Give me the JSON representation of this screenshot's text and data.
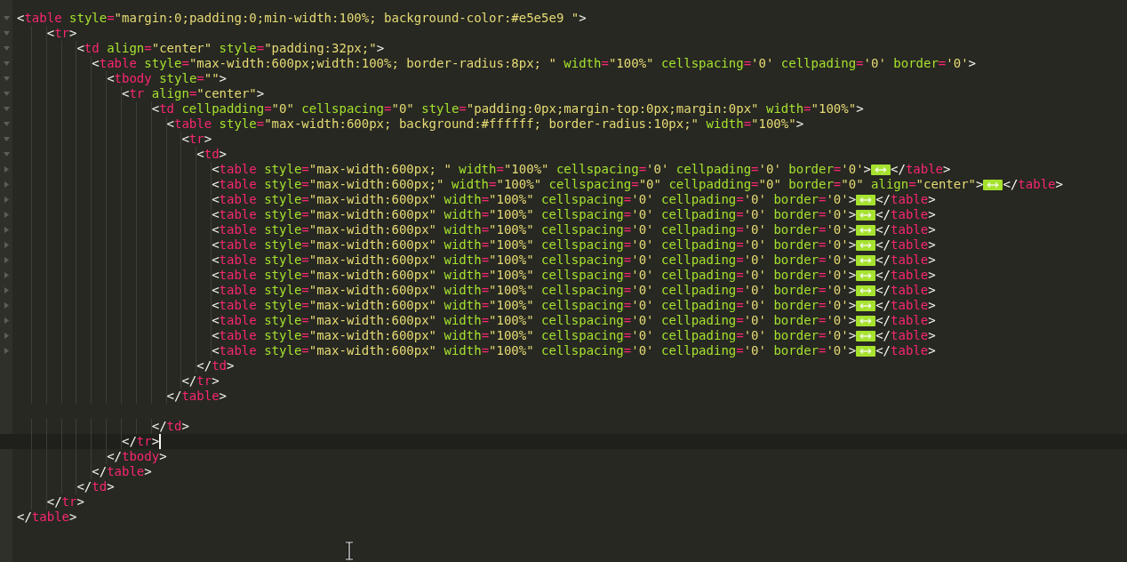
{
  "editor": {
    "lines": [
      {
        "expanded": true,
        "current": false,
        "tokens": [
          {
            "kind": "p",
            "text": "<"
          },
          {
            "kind": "tag",
            "text": "table"
          },
          {
            "kind": "attr",
            "text": " style"
          },
          {
            "kind": "eq",
            "text": "="
          },
          {
            "kind": "str",
            "text": "\"margin:0;padding:0;min-width:100%; background-color:#e5e5e9 \""
          },
          {
            "kind": "p",
            "text": ">"
          }
        ]
      },
      {
        "expanded": true,
        "current": false,
        "tokens": [
          {
            "kind": "p",
            "text": "    <"
          },
          {
            "kind": "tag",
            "text": "tr"
          },
          {
            "kind": "p",
            "text": ">"
          }
        ]
      },
      {
        "expanded": true,
        "current": false,
        "tokens": [
          {
            "kind": "p",
            "text": "        <"
          },
          {
            "kind": "tag",
            "text": "td"
          },
          {
            "kind": "attr",
            "text": " align"
          },
          {
            "kind": "eq",
            "text": "="
          },
          {
            "kind": "str",
            "text": "\"center\""
          },
          {
            "kind": "attr",
            "text": " style"
          },
          {
            "kind": "eq",
            "text": "="
          },
          {
            "kind": "str",
            "text": "\"padding:32px;\""
          },
          {
            "kind": "p",
            "text": ">"
          }
        ]
      },
      {
        "expanded": true,
        "current": false,
        "tokens": [
          {
            "kind": "p",
            "text": "          <"
          },
          {
            "kind": "tag",
            "text": "table"
          },
          {
            "kind": "attr",
            "text": " style"
          },
          {
            "kind": "eq",
            "text": "="
          },
          {
            "kind": "str",
            "text": "\"max-width:600px;width:100%; border-radius:8px; \""
          },
          {
            "kind": "attr",
            "text": " width"
          },
          {
            "kind": "eq",
            "text": "="
          },
          {
            "kind": "str",
            "text": "\"100%\""
          },
          {
            "kind": "attr",
            "text": " cellspacing"
          },
          {
            "kind": "eq",
            "text": "="
          },
          {
            "kind": "str",
            "text": "'0'"
          },
          {
            "kind": "attr",
            "text": " cellpading"
          },
          {
            "kind": "eq",
            "text": "="
          },
          {
            "kind": "str",
            "text": "'0'"
          },
          {
            "kind": "attr",
            "text": " border"
          },
          {
            "kind": "eq",
            "text": "="
          },
          {
            "kind": "str",
            "text": "'0'"
          },
          {
            "kind": "p",
            "text": ">"
          }
        ]
      },
      {
        "expanded": true,
        "current": false,
        "tokens": [
          {
            "kind": "p",
            "text": "            <"
          },
          {
            "kind": "tag",
            "text": "tbody"
          },
          {
            "kind": "attr",
            "text": " style"
          },
          {
            "kind": "eq",
            "text": "="
          },
          {
            "kind": "str",
            "text": "\"\""
          },
          {
            "kind": "p",
            "text": ">"
          }
        ]
      },
      {
        "expanded": true,
        "current": false,
        "tokens": [
          {
            "kind": "p",
            "text": "              <"
          },
          {
            "kind": "tag",
            "text": "tr"
          },
          {
            "kind": "attr",
            "text": " align"
          },
          {
            "kind": "eq",
            "text": "="
          },
          {
            "kind": "str",
            "text": "\"center\""
          },
          {
            "kind": "p",
            "text": ">"
          }
        ]
      },
      {
        "expanded": true,
        "current": false,
        "tokens": [
          {
            "kind": "p",
            "text": "                  <"
          },
          {
            "kind": "tag",
            "text": "td"
          },
          {
            "kind": "attr",
            "text": " cellpadding"
          },
          {
            "kind": "eq",
            "text": "="
          },
          {
            "kind": "str",
            "text": "\"0\""
          },
          {
            "kind": "attr",
            "text": " cellspacing"
          },
          {
            "kind": "eq",
            "text": "="
          },
          {
            "kind": "str",
            "text": "\"0\""
          },
          {
            "kind": "attr",
            "text": " style"
          },
          {
            "kind": "eq",
            "text": "="
          },
          {
            "kind": "str",
            "text": "\"padding:0px;margin-top:0px;margin:0px\""
          },
          {
            "kind": "attr",
            "text": " width"
          },
          {
            "kind": "eq",
            "text": "="
          },
          {
            "kind": "str",
            "text": "\"100%\""
          },
          {
            "kind": "p",
            "text": ">"
          }
        ]
      },
      {
        "expanded": true,
        "current": false,
        "tokens": [
          {
            "kind": "p",
            "text": "                    <"
          },
          {
            "kind": "tag",
            "text": "table"
          },
          {
            "kind": "attr",
            "text": " style"
          },
          {
            "kind": "eq",
            "text": "="
          },
          {
            "kind": "str",
            "text": "\"max-width:600px; background:#ffffff; border-radius:10px;\""
          },
          {
            "kind": "attr",
            "text": " width"
          },
          {
            "kind": "eq",
            "text": "="
          },
          {
            "kind": "str",
            "text": "\"100%\""
          },
          {
            "kind": "p",
            "text": ">"
          }
        ]
      },
      {
        "expanded": true,
        "current": false,
        "tokens": [
          {
            "kind": "p",
            "text": "                      <"
          },
          {
            "kind": "tag",
            "text": "tr"
          },
          {
            "kind": "p",
            "text": ">"
          }
        ]
      },
      {
        "expanded": true,
        "current": false,
        "tokens": [
          {
            "kind": "p",
            "text": "                        <"
          },
          {
            "kind": "tag",
            "text": "td"
          },
          {
            "kind": "p",
            "text": ">"
          }
        ]
      },
      {
        "expanded": false,
        "current": false,
        "tokens": [
          {
            "kind": "p",
            "text": "                          <"
          },
          {
            "kind": "tag",
            "text": "table"
          },
          {
            "kind": "attr",
            "text": " style"
          },
          {
            "kind": "eq",
            "text": "="
          },
          {
            "kind": "str",
            "text": "\"max-width:600px; \""
          },
          {
            "kind": "attr",
            "text": " width"
          },
          {
            "kind": "eq",
            "text": "="
          },
          {
            "kind": "str",
            "text": "\"100%\""
          },
          {
            "kind": "attr",
            "text": " cellspacing"
          },
          {
            "kind": "eq",
            "text": "="
          },
          {
            "kind": "str",
            "text": "'0'"
          },
          {
            "kind": "attr",
            "text": " cellpading"
          },
          {
            "kind": "eq",
            "text": "="
          },
          {
            "kind": "str",
            "text": "'0'"
          },
          {
            "kind": "attr",
            "text": " border"
          },
          {
            "kind": "eq",
            "text": "="
          },
          {
            "kind": "str",
            "text": "'0'"
          },
          {
            "kind": "p",
            "text": ">"
          },
          {
            "kind": "fold"
          },
          {
            "kind": "p",
            "text": "</"
          },
          {
            "kind": "tag",
            "text": "table"
          },
          {
            "kind": "p",
            "text": ">"
          }
        ]
      },
      {
        "expanded": false,
        "current": false,
        "tokens": [
          {
            "kind": "p",
            "text": "                          <"
          },
          {
            "kind": "tag",
            "text": "table"
          },
          {
            "kind": "attr",
            "text": " style"
          },
          {
            "kind": "eq",
            "text": "="
          },
          {
            "kind": "str",
            "text": "\"max-width:600px;\""
          },
          {
            "kind": "attr",
            "text": " width"
          },
          {
            "kind": "eq",
            "text": "="
          },
          {
            "kind": "str",
            "text": "\"100%\""
          },
          {
            "kind": "attr",
            "text": " cellspacing"
          },
          {
            "kind": "eq",
            "text": "="
          },
          {
            "kind": "str",
            "text": "\"0\""
          },
          {
            "kind": "attr",
            "text": " cellpadding"
          },
          {
            "kind": "eq",
            "text": "="
          },
          {
            "kind": "str",
            "text": "\"0\""
          },
          {
            "kind": "attr",
            "text": " border"
          },
          {
            "kind": "eq",
            "text": "="
          },
          {
            "kind": "str",
            "text": "\"0\""
          },
          {
            "kind": "attr",
            "text": " align"
          },
          {
            "kind": "eq",
            "text": "="
          },
          {
            "kind": "str",
            "text": "\"center\""
          },
          {
            "kind": "p",
            "text": ">"
          },
          {
            "kind": "fold"
          },
          {
            "kind": "p",
            "text": "</"
          },
          {
            "kind": "tag",
            "text": "table"
          },
          {
            "kind": "p",
            "text": ">"
          }
        ]
      },
      {
        "expanded": false,
        "current": false,
        "tokens": [
          {
            "kind": "p",
            "text": "                          <"
          },
          {
            "kind": "tag",
            "text": "table"
          },
          {
            "kind": "attr",
            "text": " style"
          },
          {
            "kind": "eq",
            "text": "="
          },
          {
            "kind": "str",
            "text": "\"max-width:600px\""
          },
          {
            "kind": "attr",
            "text": " width"
          },
          {
            "kind": "eq",
            "text": "="
          },
          {
            "kind": "str",
            "text": "\"100%\""
          },
          {
            "kind": "attr",
            "text": " cellspacing"
          },
          {
            "kind": "eq",
            "text": "="
          },
          {
            "kind": "str",
            "text": "'0'"
          },
          {
            "kind": "attr",
            "text": " cellpading"
          },
          {
            "kind": "eq",
            "text": "="
          },
          {
            "kind": "str",
            "text": "'0'"
          },
          {
            "kind": "attr",
            "text": " border"
          },
          {
            "kind": "eq",
            "text": "="
          },
          {
            "kind": "str",
            "text": "'0'"
          },
          {
            "kind": "p",
            "text": ">"
          },
          {
            "kind": "fold"
          },
          {
            "kind": "p",
            "text": "</"
          },
          {
            "kind": "tag",
            "text": "table"
          },
          {
            "kind": "p",
            "text": ">"
          }
        ]
      },
      {
        "expanded": false,
        "current": false,
        "tokens": [
          {
            "kind": "p",
            "text": "                          <"
          },
          {
            "kind": "tag",
            "text": "table"
          },
          {
            "kind": "attr",
            "text": " style"
          },
          {
            "kind": "eq",
            "text": "="
          },
          {
            "kind": "str",
            "text": "\"max-width:600px\""
          },
          {
            "kind": "attr",
            "text": " width"
          },
          {
            "kind": "eq",
            "text": "="
          },
          {
            "kind": "str",
            "text": "\"100%\""
          },
          {
            "kind": "attr",
            "text": " cellspacing"
          },
          {
            "kind": "eq",
            "text": "="
          },
          {
            "kind": "str",
            "text": "'0'"
          },
          {
            "kind": "attr",
            "text": " cellpading"
          },
          {
            "kind": "eq",
            "text": "="
          },
          {
            "kind": "str",
            "text": "'0'"
          },
          {
            "kind": "attr",
            "text": " border"
          },
          {
            "kind": "eq",
            "text": "="
          },
          {
            "kind": "str",
            "text": "'0'"
          },
          {
            "kind": "p",
            "text": ">"
          },
          {
            "kind": "fold"
          },
          {
            "kind": "p",
            "text": "</"
          },
          {
            "kind": "tag",
            "text": "table"
          },
          {
            "kind": "p",
            "text": ">"
          }
        ]
      },
      {
        "expanded": false,
        "current": false,
        "tokens": [
          {
            "kind": "p",
            "text": "                          <"
          },
          {
            "kind": "tag",
            "text": "table"
          },
          {
            "kind": "attr",
            "text": " style"
          },
          {
            "kind": "eq",
            "text": "="
          },
          {
            "kind": "str",
            "text": "\"max-width:600px\""
          },
          {
            "kind": "attr",
            "text": " width"
          },
          {
            "kind": "eq",
            "text": "="
          },
          {
            "kind": "str",
            "text": "\"100%\""
          },
          {
            "kind": "attr",
            "text": " cellspacing"
          },
          {
            "kind": "eq",
            "text": "="
          },
          {
            "kind": "str",
            "text": "'0'"
          },
          {
            "kind": "attr",
            "text": " cellpading"
          },
          {
            "kind": "eq",
            "text": "="
          },
          {
            "kind": "str",
            "text": "'0'"
          },
          {
            "kind": "attr",
            "text": " border"
          },
          {
            "kind": "eq",
            "text": "="
          },
          {
            "kind": "str",
            "text": "'0'"
          },
          {
            "kind": "p",
            "text": ">"
          },
          {
            "kind": "fold"
          },
          {
            "kind": "p",
            "text": "</"
          },
          {
            "kind": "tag",
            "text": "table"
          },
          {
            "kind": "p",
            "text": ">"
          }
        ]
      },
      {
        "expanded": false,
        "current": false,
        "tokens": [
          {
            "kind": "p",
            "text": "                          <"
          },
          {
            "kind": "tag",
            "text": "table"
          },
          {
            "kind": "attr",
            "text": " style"
          },
          {
            "kind": "eq",
            "text": "="
          },
          {
            "kind": "str",
            "text": "\"max-width:600px\""
          },
          {
            "kind": "attr",
            "text": " width"
          },
          {
            "kind": "eq",
            "text": "="
          },
          {
            "kind": "str",
            "text": "\"100%\""
          },
          {
            "kind": "attr",
            "text": " cellspacing"
          },
          {
            "kind": "eq",
            "text": "="
          },
          {
            "kind": "str",
            "text": "'0'"
          },
          {
            "kind": "attr",
            "text": " cellpading"
          },
          {
            "kind": "eq",
            "text": "="
          },
          {
            "kind": "str",
            "text": "'0'"
          },
          {
            "kind": "attr",
            "text": " border"
          },
          {
            "kind": "eq",
            "text": "="
          },
          {
            "kind": "str",
            "text": "'0'"
          },
          {
            "kind": "p",
            "text": ">"
          },
          {
            "kind": "fold"
          },
          {
            "kind": "p",
            "text": "</"
          },
          {
            "kind": "tag",
            "text": "table"
          },
          {
            "kind": "p",
            "text": ">"
          }
        ]
      },
      {
        "expanded": false,
        "current": false,
        "tokens": [
          {
            "kind": "p",
            "text": "                          <"
          },
          {
            "kind": "tag",
            "text": "table"
          },
          {
            "kind": "attr",
            "text": " style"
          },
          {
            "kind": "eq",
            "text": "="
          },
          {
            "kind": "str",
            "text": "\"max-width:600px\""
          },
          {
            "kind": "attr",
            "text": " width"
          },
          {
            "kind": "eq",
            "text": "="
          },
          {
            "kind": "str",
            "text": "\"100%\""
          },
          {
            "kind": "attr",
            "text": " cellspacing"
          },
          {
            "kind": "eq",
            "text": "="
          },
          {
            "kind": "str",
            "text": "'0'"
          },
          {
            "kind": "attr",
            "text": " cellpading"
          },
          {
            "kind": "eq",
            "text": "="
          },
          {
            "kind": "str",
            "text": "'0'"
          },
          {
            "kind": "attr",
            "text": " border"
          },
          {
            "kind": "eq",
            "text": "="
          },
          {
            "kind": "str",
            "text": "'0'"
          },
          {
            "kind": "p",
            "text": ">"
          },
          {
            "kind": "fold"
          },
          {
            "kind": "p",
            "text": "</"
          },
          {
            "kind": "tag",
            "text": "table"
          },
          {
            "kind": "p",
            "text": ">"
          }
        ]
      },
      {
        "expanded": false,
        "current": false,
        "tokens": [
          {
            "kind": "p",
            "text": "                          <"
          },
          {
            "kind": "tag",
            "text": "table"
          },
          {
            "kind": "attr",
            "text": " style"
          },
          {
            "kind": "eq",
            "text": "="
          },
          {
            "kind": "str",
            "text": "\"max-width:600px\""
          },
          {
            "kind": "attr",
            "text": " width"
          },
          {
            "kind": "eq",
            "text": "="
          },
          {
            "kind": "str",
            "text": "\"100%\""
          },
          {
            "kind": "attr",
            "text": " cellspacing"
          },
          {
            "kind": "eq",
            "text": "="
          },
          {
            "kind": "str",
            "text": "'0'"
          },
          {
            "kind": "attr",
            "text": " cellpading"
          },
          {
            "kind": "eq",
            "text": "="
          },
          {
            "kind": "str",
            "text": "'0'"
          },
          {
            "kind": "attr",
            "text": " border"
          },
          {
            "kind": "eq",
            "text": "="
          },
          {
            "kind": "str",
            "text": "'0'"
          },
          {
            "kind": "p",
            "text": ">"
          },
          {
            "kind": "fold"
          },
          {
            "kind": "p",
            "text": "</"
          },
          {
            "kind": "tag",
            "text": "table"
          },
          {
            "kind": "p",
            "text": ">"
          }
        ]
      },
      {
        "expanded": false,
        "current": false,
        "tokens": [
          {
            "kind": "p",
            "text": "                          <"
          },
          {
            "kind": "tag",
            "text": "table"
          },
          {
            "kind": "attr",
            "text": " style"
          },
          {
            "kind": "eq",
            "text": "="
          },
          {
            "kind": "str",
            "text": "\"max-width:600px\""
          },
          {
            "kind": "attr",
            "text": " width"
          },
          {
            "kind": "eq",
            "text": "="
          },
          {
            "kind": "str",
            "text": "\"100%\""
          },
          {
            "kind": "attr",
            "text": " cellspacing"
          },
          {
            "kind": "eq",
            "text": "="
          },
          {
            "kind": "str",
            "text": "'0'"
          },
          {
            "kind": "attr",
            "text": " cellpading"
          },
          {
            "kind": "eq",
            "text": "="
          },
          {
            "kind": "str",
            "text": "'0'"
          },
          {
            "kind": "attr",
            "text": " border"
          },
          {
            "kind": "eq",
            "text": "="
          },
          {
            "kind": "str",
            "text": "'0'"
          },
          {
            "kind": "p",
            "text": ">"
          },
          {
            "kind": "fold"
          },
          {
            "kind": "p",
            "text": "</"
          },
          {
            "kind": "tag",
            "text": "table"
          },
          {
            "kind": "p",
            "text": ">"
          }
        ]
      },
      {
        "expanded": false,
        "current": false,
        "tokens": [
          {
            "kind": "p",
            "text": "                          <"
          },
          {
            "kind": "tag",
            "text": "table"
          },
          {
            "kind": "attr",
            "text": " style"
          },
          {
            "kind": "eq",
            "text": "="
          },
          {
            "kind": "str",
            "text": "\"max-width:600px\""
          },
          {
            "kind": "attr",
            "text": " width"
          },
          {
            "kind": "eq",
            "text": "="
          },
          {
            "kind": "str",
            "text": "\"100%\""
          },
          {
            "kind": "attr",
            "text": " cellspacing"
          },
          {
            "kind": "eq",
            "text": "="
          },
          {
            "kind": "str",
            "text": "'0'"
          },
          {
            "kind": "attr",
            "text": " cellpading"
          },
          {
            "kind": "eq",
            "text": "="
          },
          {
            "kind": "str",
            "text": "'0'"
          },
          {
            "kind": "attr",
            "text": " border"
          },
          {
            "kind": "eq",
            "text": "="
          },
          {
            "kind": "str",
            "text": "'0'"
          },
          {
            "kind": "p",
            "text": ">"
          },
          {
            "kind": "fold"
          },
          {
            "kind": "p",
            "text": "</"
          },
          {
            "kind": "tag",
            "text": "table"
          },
          {
            "kind": "p",
            "text": ">"
          }
        ]
      },
      {
        "expanded": false,
        "current": false,
        "tokens": [
          {
            "kind": "p",
            "text": "                          <"
          },
          {
            "kind": "tag",
            "text": "table"
          },
          {
            "kind": "attr",
            "text": " style"
          },
          {
            "kind": "eq",
            "text": "="
          },
          {
            "kind": "str",
            "text": "\"max-width:600px\""
          },
          {
            "kind": "attr",
            "text": " width"
          },
          {
            "kind": "eq",
            "text": "="
          },
          {
            "kind": "str",
            "text": "\"100%\""
          },
          {
            "kind": "attr",
            "text": " cellspacing"
          },
          {
            "kind": "eq",
            "text": "="
          },
          {
            "kind": "str",
            "text": "'0'"
          },
          {
            "kind": "attr",
            "text": " cellpading"
          },
          {
            "kind": "eq",
            "text": "="
          },
          {
            "kind": "str",
            "text": "'0'"
          },
          {
            "kind": "attr",
            "text": " border"
          },
          {
            "kind": "eq",
            "text": "="
          },
          {
            "kind": "str",
            "text": "'0'"
          },
          {
            "kind": "p",
            "text": ">"
          },
          {
            "kind": "fold"
          },
          {
            "kind": "p",
            "text": "</"
          },
          {
            "kind": "tag",
            "text": "table"
          },
          {
            "kind": "p",
            "text": ">"
          }
        ]
      },
      {
        "expanded": false,
        "current": false,
        "tokens": [
          {
            "kind": "p",
            "text": "                          <"
          },
          {
            "kind": "tag",
            "text": "table"
          },
          {
            "kind": "attr",
            "text": " style"
          },
          {
            "kind": "eq",
            "text": "="
          },
          {
            "kind": "str",
            "text": "\"max-width:600px\""
          },
          {
            "kind": "attr",
            "text": " width"
          },
          {
            "kind": "eq",
            "text": "="
          },
          {
            "kind": "str",
            "text": "\"100%\""
          },
          {
            "kind": "attr",
            "text": " cellspacing"
          },
          {
            "kind": "eq",
            "text": "="
          },
          {
            "kind": "str",
            "text": "'0'"
          },
          {
            "kind": "attr",
            "text": " cellpading"
          },
          {
            "kind": "eq",
            "text": "="
          },
          {
            "kind": "str",
            "text": "'0'"
          },
          {
            "kind": "attr",
            "text": " border"
          },
          {
            "kind": "eq",
            "text": "="
          },
          {
            "kind": "str",
            "text": "'0'"
          },
          {
            "kind": "p",
            "text": ">"
          },
          {
            "kind": "fold"
          },
          {
            "kind": "p",
            "text": "</"
          },
          {
            "kind": "tag",
            "text": "table"
          },
          {
            "kind": "p",
            "text": ">"
          }
        ]
      },
      {
        "expanded": false,
        "current": false,
        "tokens": [
          {
            "kind": "p",
            "text": "                          <"
          },
          {
            "kind": "tag",
            "text": "table"
          },
          {
            "kind": "attr",
            "text": " style"
          },
          {
            "kind": "eq",
            "text": "="
          },
          {
            "kind": "str",
            "text": "\"max-width:600px\""
          },
          {
            "kind": "attr",
            "text": " width"
          },
          {
            "kind": "eq",
            "text": "="
          },
          {
            "kind": "str",
            "text": "\"100%\""
          },
          {
            "kind": "attr",
            "text": " cellspacing"
          },
          {
            "kind": "eq",
            "text": "="
          },
          {
            "kind": "str",
            "text": "'0'"
          },
          {
            "kind": "attr",
            "text": " cellpading"
          },
          {
            "kind": "eq",
            "text": "="
          },
          {
            "kind": "str",
            "text": "'0'"
          },
          {
            "kind": "attr",
            "text": " border"
          },
          {
            "kind": "eq",
            "text": "="
          },
          {
            "kind": "str",
            "text": "'0'"
          },
          {
            "kind": "p",
            "text": ">"
          },
          {
            "kind": "fold"
          },
          {
            "kind": "p",
            "text": "</"
          },
          {
            "kind": "tag",
            "text": "table"
          },
          {
            "kind": "p",
            "text": ">"
          }
        ]
      },
      {
        "current": false,
        "tokens": [
          {
            "kind": "p",
            "text": "                        </"
          },
          {
            "kind": "tag",
            "text": "td"
          },
          {
            "kind": "p",
            "text": ">"
          }
        ]
      },
      {
        "current": false,
        "tokens": [
          {
            "kind": "p",
            "text": "                      </"
          },
          {
            "kind": "tag",
            "text": "tr"
          },
          {
            "kind": "p",
            "text": ">"
          }
        ]
      },
      {
        "current": false,
        "tokens": [
          {
            "kind": "p",
            "text": "                    </"
          },
          {
            "kind": "tag",
            "text": "table"
          },
          {
            "kind": "p",
            "text": ">"
          }
        ]
      },
      {
        "current": false
      },
      {
        "current": false,
        "tokens": [
          {
            "kind": "p",
            "text": "                  </"
          },
          {
            "kind": "tag",
            "text": "td"
          },
          {
            "kind": "p",
            "text": ">"
          }
        ]
      },
      {
        "current": true,
        "tokens": [
          {
            "kind": "p",
            "text": "              </"
          },
          {
            "kind": "tag",
            "text": "tr"
          },
          {
            "kind": "p",
            "text": ">"
          }
        ]
      },
      {
        "current": false,
        "tokens": [
          {
            "kind": "p",
            "text": "            </"
          },
          {
            "kind": "tag",
            "text": "tbody"
          },
          {
            "kind": "p",
            "text": ">"
          }
        ]
      },
      {
        "current": false,
        "tokens": [
          {
            "kind": "p",
            "text": "          </"
          },
          {
            "kind": "tag",
            "text": "table"
          },
          {
            "kind": "p",
            "text": ">"
          }
        ]
      },
      {
        "current": false,
        "tokens": [
          {
            "kind": "p",
            "text": "        </"
          },
          {
            "kind": "tag",
            "text": "td"
          },
          {
            "kind": "p",
            "text": ">"
          }
        ]
      },
      {
        "current": false,
        "tokens": [
          {
            "kind": "p",
            "text": "    </"
          },
          {
            "kind": "tag",
            "text": "tr"
          },
          {
            "kind": "p",
            "text": ">"
          }
        ]
      },
      {
        "current": false,
        "tokens": [
          {
            "kind": "p",
            "text": "</"
          },
          {
            "kind": "tag",
            "text": "table"
          },
          {
            "kind": "p",
            "text": ">"
          }
        ]
      }
    ]
  }
}
